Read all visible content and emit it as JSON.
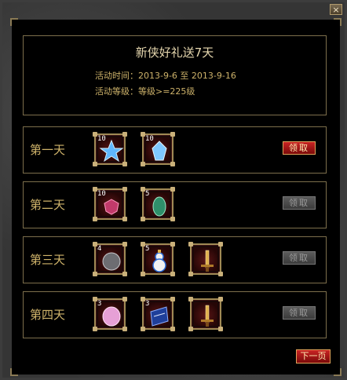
{
  "window": {
    "close_glyph": "×"
  },
  "header": {
    "title": "新侠好礼送7天",
    "time_line": "活动时间：2013-9-6 至 2013-9-16",
    "level_line": "活动等级：等级>=225级"
  },
  "days": [
    {
      "label": "第一天",
      "claim_label": "领取",
      "claim_enabled": true,
      "items": [
        {
          "count": "10",
          "icon": "star-crystal-icon"
        },
        {
          "count": "10",
          "icon": "blue-gem-icon"
        }
      ]
    },
    {
      "label": "第二天",
      "claim_label": "领取",
      "claim_enabled": false,
      "items": [
        {
          "count": "10",
          "icon": "red-gem-icon"
        },
        {
          "count": "5",
          "icon": "green-jade-icon"
        }
      ]
    },
    {
      "label": "第三天",
      "claim_label": "领取",
      "claim_enabled": false,
      "items": [
        {
          "count": "4",
          "icon": "stone-orb-icon"
        },
        {
          "count": "5",
          "icon": "gourd-icon"
        },
        {
          "count": "",
          "icon": "sword-icon"
        }
      ]
    },
    {
      "label": "第四天",
      "claim_label": "领取",
      "claim_enabled": false,
      "items": [
        {
          "count": "3",
          "icon": "pink-egg-icon"
        },
        {
          "count": "3",
          "icon": "book-icon"
        },
        {
          "count": "",
          "icon": "sword-icon"
        }
      ]
    }
  ],
  "footer": {
    "next_label": "下一页"
  },
  "colors": {
    "gold_border": "#7d6f4c",
    "claim_active": "#c92424",
    "claim_disabled": "#5b5b5b"
  }
}
